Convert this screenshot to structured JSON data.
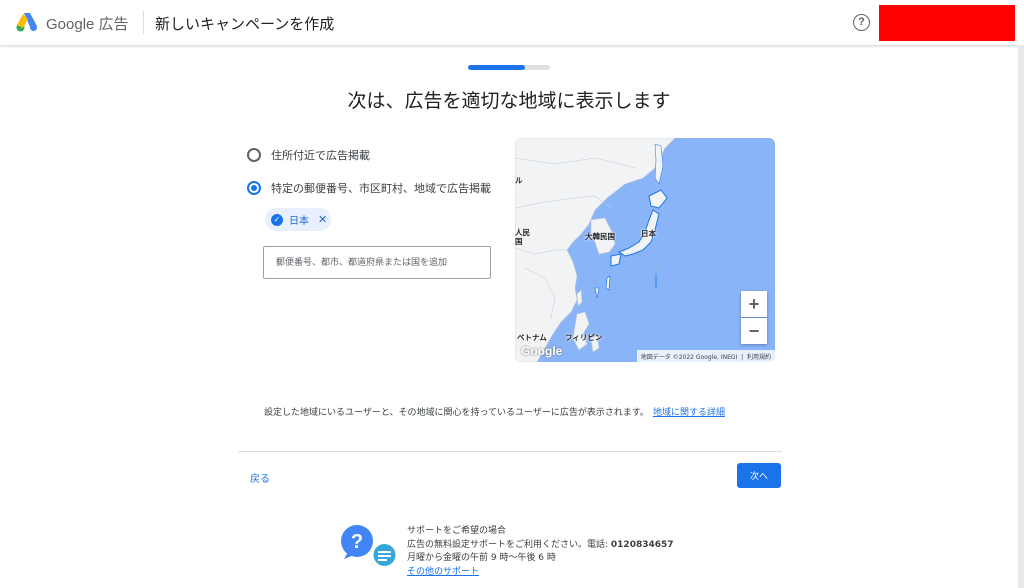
{
  "header": {
    "brand_google": "Google",
    "brand_product": "広告",
    "title": "新しいキャンペーンを作成",
    "help_glyph": "?"
  },
  "progress": {
    "fraction": 0.7
  },
  "main": {
    "title": "次は、広告を適切な地域に表示します",
    "options": [
      {
        "label": "住所付近で広告掲載",
        "selected": false
      },
      {
        "label": "特定の郵便番号、市区町村、地域で広告掲載",
        "selected": true
      }
    ],
    "chip": {
      "label": "日本",
      "check_glyph": "✓",
      "close_glyph": "✕"
    },
    "search": {
      "placeholder": "郵便番号、都市、都道府県または国を追加"
    }
  },
  "map": {
    "labels": {
      "korea": "大韓民国",
      "japan": "日本",
      "vietnam": "ベトナム",
      "philippines": "フィリピン",
      "left_top": "ル",
      "left_mid": "人民",
      "left_mid2": "国"
    },
    "zoom_in": "+",
    "zoom_out": "−",
    "google_mark": "Google",
    "credit": "地図データ ©2022 Google, INEGI",
    "terms": "利用規約"
  },
  "info": {
    "text": "設定した地域にいるユーザーと、その地域に関心を持っているユーザーに広告が表示されます。",
    "link": "地域に関する詳細"
  },
  "nav": {
    "back": "戻る",
    "next": "次へ"
  },
  "support": {
    "heading": "サポートをご希望の場合",
    "line2_prefix": "広告の無料設定サポートをご利用ください。電話: ",
    "phone": "0120834657",
    "hours": "月曜から金曜の午前 9 時〜午後 6 時",
    "link": "その他のサポート"
  },
  "colors": {
    "accent": "#1a73e8",
    "account_block": "#ff0000",
    "map_water": "#8ab4f8",
    "map_land": "#f1f3f4"
  }
}
